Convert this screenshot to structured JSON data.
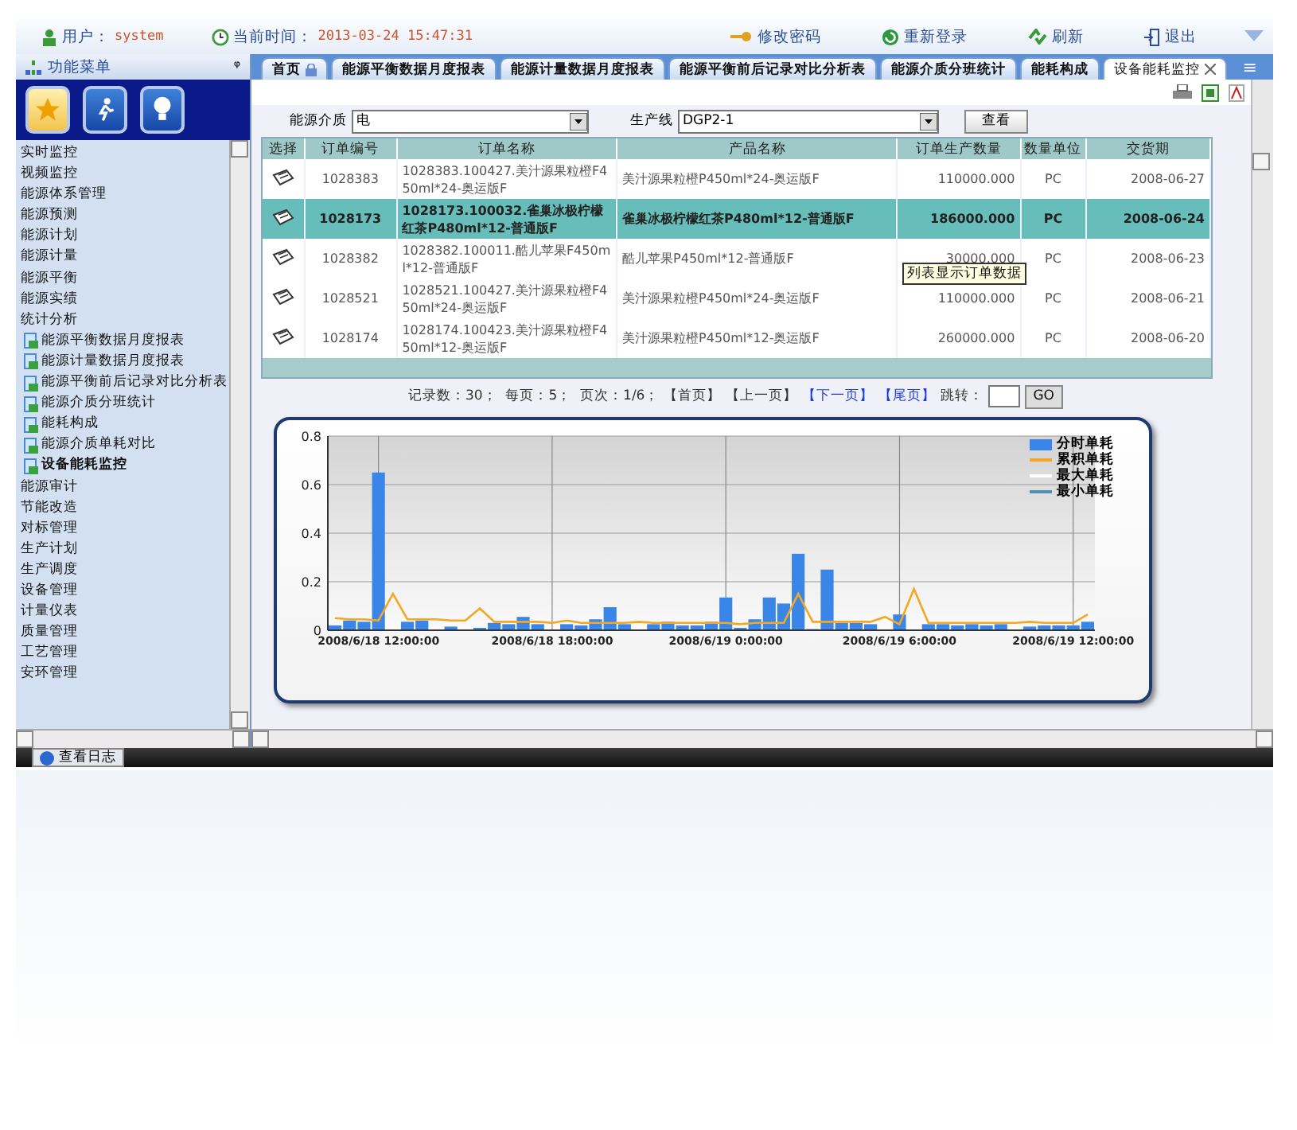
{
  "top_bar": {
    "user_label": "用户：",
    "user_name": "system",
    "time_label": "当前时间：",
    "time_value": "2013-03-24 15:47:31",
    "actions": [
      {
        "kind": "key",
        "label": "修改密码"
      },
      {
        "kind": "refresh",
        "label": "重新登录"
      },
      {
        "kind": "recycle",
        "label": "刷新"
      },
      {
        "kind": "exit",
        "label": "退出"
      }
    ]
  },
  "sidebar": {
    "title": "功能菜单",
    "pin": "ᵠ",
    "shortcuts": [
      {
        "kind": "star",
        "selected": true
      },
      {
        "kind": "runner",
        "selected": false
      },
      {
        "kind": "bulb",
        "selected": false
      }
    ],
    "items": [
      {
        "label": "实时监控",
        "selected": false
      },
      {
        "label": "视频监控",
        "selected": false
      },
      {
        "label": "能源体系管理",
        "selected": false
      },
      {
        "label": "能源预测",
        "selected": false
      },
      {
        "label": "能源计划",
        "selected": false
      },
      {
        "label": "能源计量",
        "selected": false
      },
      {
        "label": "能源平衡",
        "selected": false
      },
      {
        "label": "能源实绩",
        "selected": false
      },
      {
        "label": "统计分析",
        "selected": false,
        "children": [
          {
            "label": "能源平衡数据月度报表",
            "selected": false
          },
          {
            "label": "能源计量数据月度报表",
            "selected": false
          },
          {
            "label": "能源平衡前后记录对比分析表",
            "selected": false
          },
          {
            "label": "能源介质分班统计",
            "selected": false
          },
          {
            "label": "能耗构成",
            "selected": false
          },
          {
            "label": "能源介质单耗对比",
            "selected": false
          },
          {
            "label": "设备能耗监控",
            "selected": true
          }
        ]
      },
      {
        "label": "能源审计",
        "selected": false
      },
      {
        "label": "节能改造",
        "selected": false
      },
      {
        "label": "对标管理",
        "selected": false
      },
      {
        "label": "生产计划",
        "selected": false
      },
      {
        "label": "生产调度",
        "selected": false
      },
      {
        "label": "设备管理",
        "selected": false
      },
      {
        "label": "计量仪表",
        "selected": false
      },
      {
        "label": "质量管理",
        "selected": false
      },
      {
        "label": "工艺管理",
        "selected": false
      },
      {
        "label": "安环管理",
        "selected": false
      }
    ]
  },
  "tabs": [
    {
      "label": "首页",
      "selected": false,
      "lockable": true
    },
    {
      "label": "能源平衡数据月度报表",
      "selected": false
    },
    {
      "label": "能源计量数据月度报表",
      "selected": false
    },
    {
      "label": "能源平衡前后记录对比分析表",
      "selected": false
    },
    {
      "label": "能源介质分班统计",
      "selected": false
    },
    {
      "label": "能耗构成",
      "selected": false
    },
    {
      "label": "设备能耗监控",
      "selected": true,
      "closable": true
    }
  ],
  "tab_menu": "≡",
  "filters": [
    {
      "label": "能源介质",
      "value": "电"
    },
    {
      "label": "生产线",
      "value": "DGP2-1"
    }
  ],
  "view_button": "查看",
  "table": {
    "columns": [
      "选择",
      "订单编号",
      "订单名称",
      "产品名称",
      "订单生产数量",
      "数量单位",
      "交货期"
    ],
    "rows": [
      {
        "selected": false,
        "cells": [
          "",
          "1028383",
          "1028383.100427.美汁源果粒橙F450ml*24-奥运版F",
          "美汁源果粒橙P450ml*24-奥运版F",
          "110000.000",
          "PC",
          "2008-06-27"
        ]
      },
      {
        "selected": true,
        "cells": [
          "",
          "1028173",
          "1028173.100032.雀巢冰极柠檬红茶P480ml*12-普通版F",
          "雀巢冰极柠檬红茶P480ml*12-普通版F",
          "186000.000",
          "PC",
          "2008-06-24"
        ]
      },
      {
        "selected": false,
        "cells": [
          "",
          "1028382",
          "1028382.100011.酷儿苹果F450ml*12-普通版F",
          "酷儿苹果P450ml*12-普通版F",
          "30000.000",
          "PC",
          "2008-06-23"
        ]
      },
      {
        "selected": false,
        "cells": [
          "",
          "1028521",
          "1028521.100427.美汁源果粒橙F450ml*24-奥运版F",
          "美汁源果粒橙P450ml*24-奥运版F",
          "110000.000",
          "PC",
          "2008-06-21"
        ]
      },
      {
        "selected": false,
        "cells": [
          "",
          "1028174",
          "1028174.100423.美汁源果粒橙F450ml*12-奥运版F",
          "美汁源果粒橙P450ml*12-奥运版F",
          "260000.000",
          "PC",
          "2008-06-20"
        ]
      }
    ],
    "tooltip": "列表显示订单数据"
  },
  "pager": {
    "summary": "记录数：30；  每页：5；  页次：1/6；",
    "links": [
      {
        "label": "【首页】",
        "disabled": true
      },
      {
        "label": "【上一页】",
        "disabled": true
      },
      {
        "label": "【下一页】",
        "disabled": false
      },
      {
        "label": "【尾页】",
        "disabled": false
      }
    ],
    "jump_label": "跳转：",
    "go": "GO"
  },
  "chart": {
    "legend_extra": [
      {
        "name": "最大单耗",
        "color": "#ffffff"
      },
      {
        "name": "最小单耗",
        "color": "#4f8fb0"
      }
    ],
    "chart_data": {
      "type": "bar",
      "grid": true,
      "ylim": [
        0,
        0.8
      ],
      "yticks": [
        0,
        0.2,
        0.4,
        0.6,
        0.8
      ],
      "categories": [
        null,
        null,
        null,
        "2008/6/18 12:00:00",
        null,
        null,
        null,
        null,
        null,
        null,
        null,
        null,
        null,
        null,
        null,
        "2008/6/18 18:00:00",
        null,
        null,
        null,
        null,
        null,
        null,
        null,
        null,
        null,
        null,
        null,
        "2008/6/19 0:00:00",
        null,
        null,
        null,
        null,
        null,
        null,
        null,
        null,
        null,
        null,
        null,
        "2008/6/19 6:00:00",
        null,
        null,
        null,
        null,
        null,
        null,
        null,
        null,
        null,
        null,
        null,
        "2008/6/19 12:00:00",
        null
      ],
      "series": [
        {
          "name": "分时单耗",
          "type": "bar",
          "color": "#3a86e8",
          "values": [
            0.02,
            0.04,
            0.035,
            0.65,
            0,
            0.035,
            0.04,
            0,
            0.015,
            0,
            0.01,
            0.03,
            0.025,
            0.055,
            0.025,
            0,
            0.025,
            0.02,
            0.045,
            0.095,
            0.025,
            0,
            0.025,
            0.035,
            0.02,
            0.02,
            0.035,
            0.135,
            0.01,
            0.045,
            0.135,
            0.11,
            0.315,
            0.005,
            0.25,
            0.03,
            0.03,
            0.025,
            0,
            0.065,
            0,
            0.025,
            0.025,
            0.02,
            0.025,
            0.02,
            0.025,
            0,
            0.015,
            0.02,
            0.02,
            0.02,
            0.035
          ]
        },
        {
          "name": "累积单耗",
          "type": "line",
          "color": "#f5a623",
          "values": [
            0.05,
            0.045,
            0.045,
            0.04,
            0.15,
            0.045,
            0.045,
            0.045,
            0.04,
            0.04,
            0.09,
            0.035,
            0.035,
            0.035,
            0.035,
            0.03,
            0.04,
            0.03,
            0.03,
            0.03,
            0.03,
            0.035,
            0.03,
            0.03,
            0.03,
            0.03,
            0.03,
            0.03,
            0.025,
            0.03,
            0.03,
            0.03,
            0.15,
            0.035,
            0.035,
            0.035,
            0.035,
            0.035,
            0.055,
            0.025,
            0.17,
            0.03,
            0.03,
            0.03,
            0.03,
            0.03,
            0.03,
            0.03,
            0.035,
            0.03,
            0.03,
            0.03,
            0.065
          ]
        }
      ]
    }
  },
  "footer": {
    "label": "查看日志"
  }
}
